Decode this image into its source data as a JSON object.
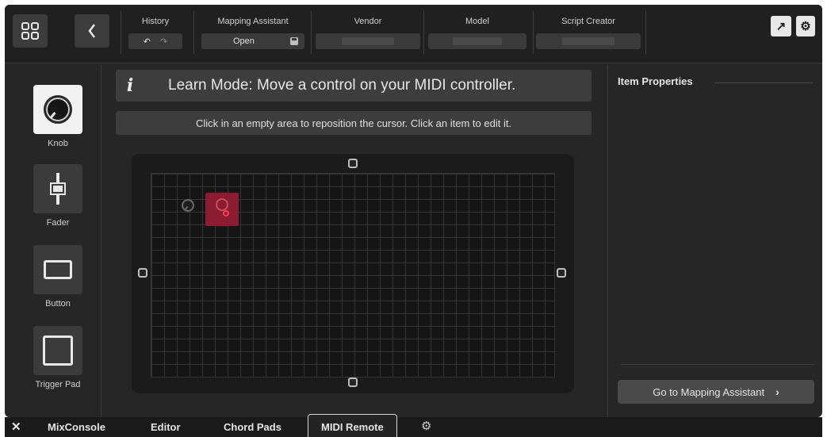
{
  "toolbar": {
    "history_label": "History",
    "mapping_label": "Mapping Assistant",
    "mapping_value": "Open",
    "vendor_label": "Vendor",
    "model_label": "Model",
    "script_label": "Script Creator",
    "undo_icon": "undo-icon",
    "redo_icon": "redo-icon"
  },
  "palette": {
    "items": [
      {
        "label": "Knob",
        "icon": "knob-icon",
        "selected": true
      },
      {
        "label": "Fader",
        "icon": "fader-icon",
        "selected": false
      },
      {
        "label": "Button",
        "icon": "button-icon",
        "selected": false
      },
      {
        "label": "Trigger Pad",
        "icon": "trigger-pad-icon",
        "selected": false
      }
    ]
  },
  "main": {
    "learn_text": "Learn Mode: Move a control on your MIDI controller.",
    "hint_text": "Click in an empty area to reposition the cursor. Click an item to edit it."
  },
  "properties": {
    "title": "Item Properties",
    "goto_button": "Go to Mapping Assistant"
  },
  "tabs": [
    {
      "label": "MixConsole",
      "active": false
    },
    {
      "label": "Editor",
      "active": false
    },
    {
      "label": "Chord Pads",
      "active": false
    },
    {
      "label": "MIDI Remote",
      "active": true
    }
  ],
  "colors": {
    "background": "#262626",
    "learn_highlight": "#8e1c30",
    "learn_cursor": "#ff3a54"
  }
}
